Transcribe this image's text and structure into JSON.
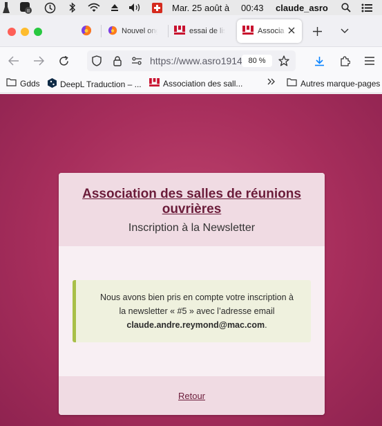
{
  "menubar": {
    "date": "Mar. 25 août à",
    "time": "00:43",
    "user": "claude_asro"
  },
  "tabs": [
    {
      "label": ""
    },
    {
      "label": "Nouvel onglet"
    },
    {
      "label": "essai de lis"
    },
    {
      "label": "Associa"
    }
  ],
  "navbar": {
    "url": "https://www.asro1914",
    "zoom": "80 %"
  },
  "bookmarks": [
    {
      "label": "Gdds"
    },
    {
      "label": "DeepL Traduction – ..."
    },
    {
      "label": "Association des sall..."
    },
    {
      "label": "Autres marque-pages"
    }
  ],
  "colors": {
    "page_background": "#a72e5c",
    "card_background": "#f8eff3",
    "card_header": "#f0dbe3",
    "title_color": "#6b1c3a",
    "alert_background": "#eff1de",
    "alert_border": "#a8bf48"
  },
  "card": {
    "title_line1": "Association des salles de réunions",
    "title_line2": "ouvrières",
    "subtitle": "Inscription à la Newsletter",
    "message_line1": "Nous avons bien pris en compte votre inscription à",
    "message_line2": "la newsletter « #5 » avec l’adresse email",
    "email": "claude.andre.reymond@mac.com",
    "period": ".",
    "back_link": "Retour"
  }
}
